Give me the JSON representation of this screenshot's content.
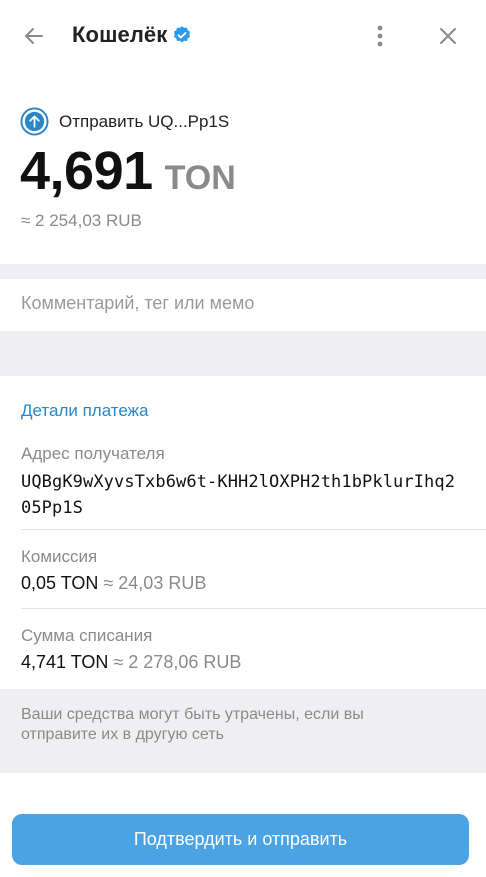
{
  "header": {
    "title": "Кошелёк",
    "back_icon": "arrow-left-icon",
    "verified_icon": "verified-badge-icon",
    "more_icon": "more-vertical-icon",
    "close_icon": "close-icon"
  },
  "transfer": {
    "send_label": "Отправить UQ...Pp1S",
    "amount": "4,691",
    "currency": "TON",
    "fiat_equivalent": "≈ 2 254,03 RUB"
  },
  "comment": {
    "placeholder": "Комментарий, тег или мемо",
    "value": ""
  },
  "details": {
    "title": "Детали платежа",
    "recipient_label": "Адрес получателя",
    "recipient_address": "UQBgK9wXyvsTxb6w6t-KHH2lOXPH2th1bPklurIhq205Pp1S",
    "fee_label": "Комиссия",
    "fee_ton": "0,05 TON",
    "fee_fiat": "≈ 24,03 RUB",
    "total_label": "Сумма списания",
    "total_ton": "4,741 TON",
    "total_fiat": "≈ 2 278,06 RUB"
  },
  "warning": {
    "text": "Ваши средства могут быть утрачены, если вы отправите их в другую сеть"
  },
  "actions": {
    "confirm_label": "Подтвердить и отправить"
  },
  "colors": {
    "accent": "#4ba3e3",
    "link": "#2a86c8",
    "muted": "#8a8a8a",
    "band": "#efeff1"
  }
}
